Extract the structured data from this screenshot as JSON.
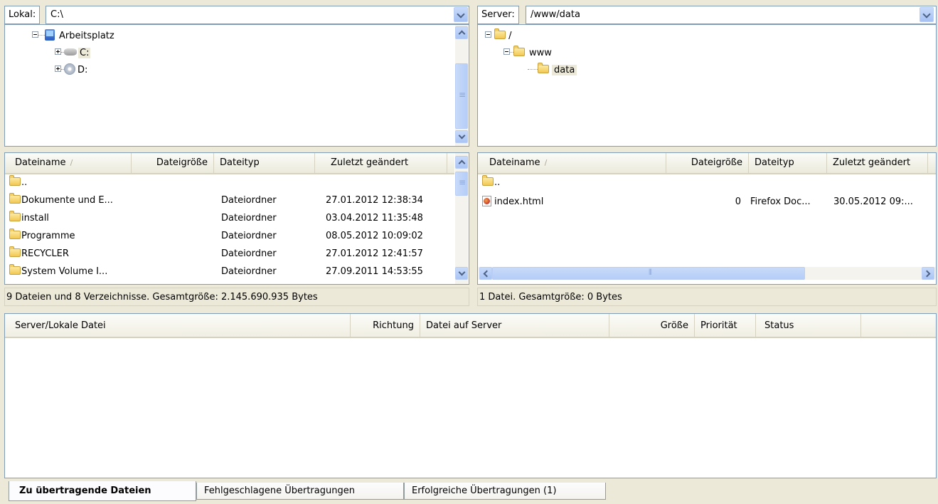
{
  "local": {
    "path_label": "Lokal:",
    "path_value": "C:\\",
    "tree": {
      "root": "Arbeitsplatz",
      "children": [
        "C:",
        "D:"
      ]
    },
    "columns": [
      "Dateiname",
      "Dateigröße",
      "Dateityp",
      "Zuletzt geändert"
    ],
    "rows": [
      {
        "name": "..",
        "size": "",
        "type": "",
        "modified": ""
      },
      {
        "name": "Dokumente und E...",
        "size": "",
        "type": "Dateiordner",
        "modified": "27.01.2012 12:38:34"
      },
      {
        "name": "install",
        "size": "",
        "type": "Dateiordner",
        "modified": "03.04.2012 11:35:48"
      },
      {
        "name": "Programme",
        "size": "",
        "type": "Dateiordner",
        "modified": "08.05.2012 10:09:02"
      },
      {
        "name": "RECYCLER",
        "size": "",
        "type": "Dateiordner",
        "modified": "27.01.2012 12:41:57"
      },
      {
        "name": "System Volume I...",
        "size": "",
        "type": "Dateiordner",
        "modified": "27.09.2011 14:53:55"
      }
    ],
    "status": "9 Dateien und 8 Verzeichnisse. Gesamtgröße: 2.145.690.935 Bytes"
  },
  "remote": {
    "path_label": "Server:",
    "path_value": "/www/data",
    "tree": {
      "root": "/",
      "child": "www",
      "grandchild": "data"
    },
    "columns": [
      "Dateiname",
      "Dateigröße",
      "Dateityp",
      "Zuletzt geändert"
    ],
    "rows": [
      {
        "name": "..",
        "size": "",
        "type": "",
        "modified": ""
      },
      {
        "name": "index.html",
        "size": "0",
        "type": "Firefox Doc...",
        "modified": "30.05.2012 09:..."
      }
    ],
    "status": "1 Datei. Gesamtgröße: 0 Bytes"
  },
  "queue": {
    "columns": [
      "Server/Lokale Datei",
      "Richtung",
      "Datei auf Server",
      "Größe",
      "Priorität",
      "Status"
    ]
  },
  "tabs": [
    {
      "label": "Zu übertragende Dateien",
      "active": true
    },
    {
      "label": "Fehlgeschlagene Übertragungen",
      "active": false
    },
    {
      "label": "Erfolgreiche Übertragungen (1)",
      "active": false
    }
  ],
  "icons": {
    "sort": "sort-ascending-icon",
    "folder": "folder-icon",
    "computer": "computer-icon",
    "drive": "hard-drive-icon",
    "cd": "cd-drive-icon",
    "html": "firefox-document-icon"
  }
}
